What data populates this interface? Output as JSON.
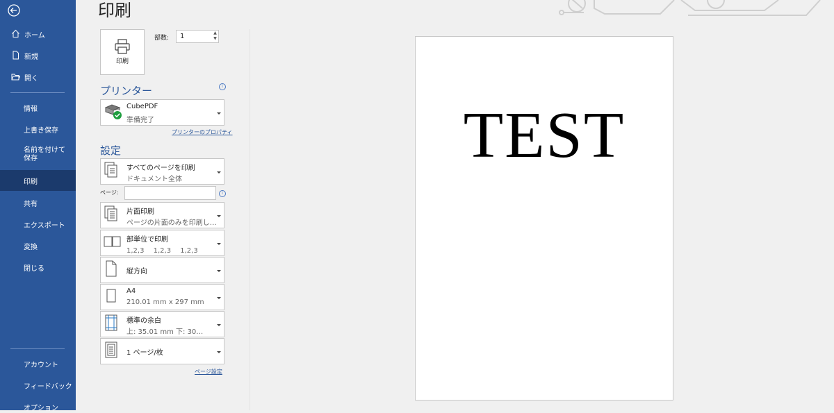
{
  "sidebar": {
    "back_label": "",
    "items": [
      {
        "label": "ホーム",
        "icon": "home-icon"
      },
      {
        "label": "新規",
        "icon": "new-document-icon"
      },
      {
        "label": "開く",
        "icon": "folder-open-icon"
      },
      {
        "label": "情報"
      },
      {
        "label": "上書き保存"
      },
      {
        "label": "名前を付けて保存"
      },
      {
        "label": "印刷",
        "active": true
      },
      {
        "label": "共有"
      },
      {
        "label": "エクスポート"
      },
      {
        "label": "変換"
      },
      {
        "label": "閉じる"
      }
    ],
    "bottom_items": [
      {
        "label": "アカウント"
      },
      {
        "label": "フィードバック"
      },
      {
        "label": "オプション"
      }
    ]
  },
  "main": {
    "title": "印刷",
    "print_button_label": "印刷",
    "copies_label": "部数:",
    "copies_value": "1"
  },
  "printer": {
    "heading": "プリンター",
    "name": "CubePDF",
    "status": "準備完了",
    "properties_link": "プリンターのプロパティ"
  },
  "settings": {
    "heading": "設定",
    "range": {
      "l1": "すべてのページを印刷",
      "l2": "ドキュメント全体"
    },
    "pages_label": "ページ:",
    "pages_value": "",
    "sides": {
      "l1": "片面印刷",
      "l2": "ページの片面のみを印刷し…"
    },
    "collate": {
      "l1": "部単位で印刷",
      "l2": "1,2,3　 1,2,3　 1,2,3"
    },
    "orientation": {
      "l1": "縦方向"
    },
    "paper": {
      "l1": "A4",
      "l2": "210.01 mm x 297 mm"
    },
    "margins": {
      "l1": "標準の余白",
      "l2": "上: 35.01 mm 下: 30…"
    },
    "per_sheet": {
      "l1": "1 ページ/枚"
    },
    "page_setup_link": "ページ設定"
  },
  "preview": {
    "text": "TEST"
  },
  "colors": {
    "sidebar_bg": "#2b579a",
    "sidebar_active": "#1b3a6c",
    "accent": "#2b579a"
  }
}
